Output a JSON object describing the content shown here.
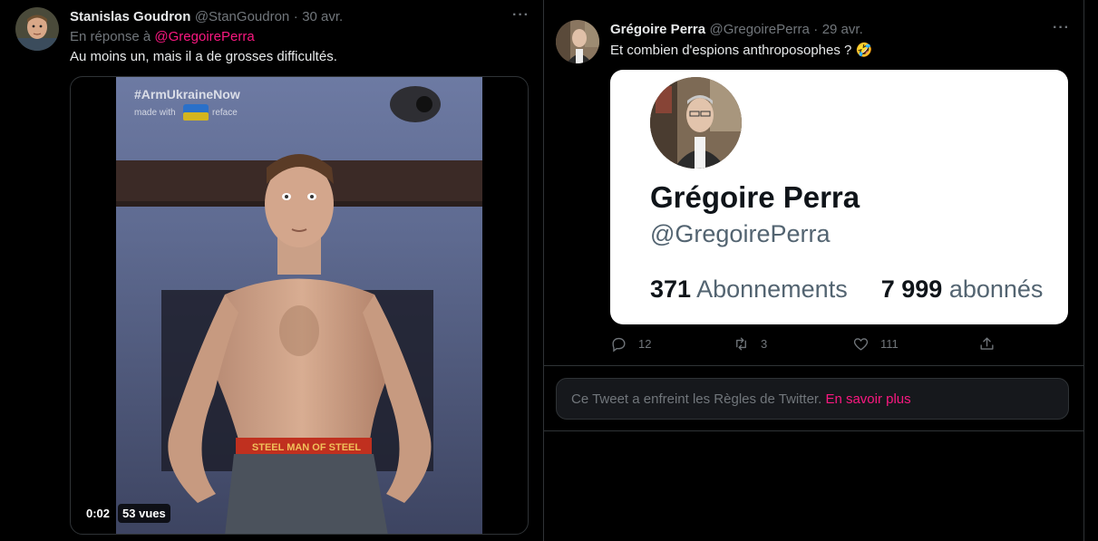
{
  "left_tweet": {
    "author_name": "Stanislas Goudron",
    "author_handle": "@StanGoudron",
    "separator": "·",
    "date": "30 avr.",
    "more_label": "···",
    "reply_prefix": "En réponse à",
    "reply_mention": "@GregoirePerra",
    "text": "Au moins un, mais il a de grosses difficultés.",
    "video": {
      "overlay_hashtag": "#ArmUkraineNow",
      "overlay_made_with": "made with",
      "overlay_brand": "reface",
      "waistband_text": "STEEL   MAN OF STEEL",
      "duration": "0:02",
      "views": "53 vues"
    }
  },
  "right_tweet": {
    "author_name": "Grégoire Perra",
    "author_handle": "@GregoirePerra",
    "separator": "·",
    "date": "29 avr.",
    "more_label": "···",
    "text": "Et combien d'espions anthroposophes ? 🤣",
    "quote_card": {
      "name": "Grégoire Perra",
      "handle": "@GregoirePerra",
      "following_count": "371",
      "following_label": "Abonnements",
      "followers_count": "7 999",
      "followers_label": "abonnés"
    },
    "actions": {
      "replies": "12",
      "retweets": "3",
      "likes": "111"
    }
  },
  "notice": {
    "text": "Ce Tweet a enfreint les Règles de Twitter.",
    "link": "En savoir plus"
  },
  "colors": {
    "background": "#000000",
    "accent_pink": "#f91880",
    "muted": "#71767b",
    "border": "#2f3336"
  }
}
